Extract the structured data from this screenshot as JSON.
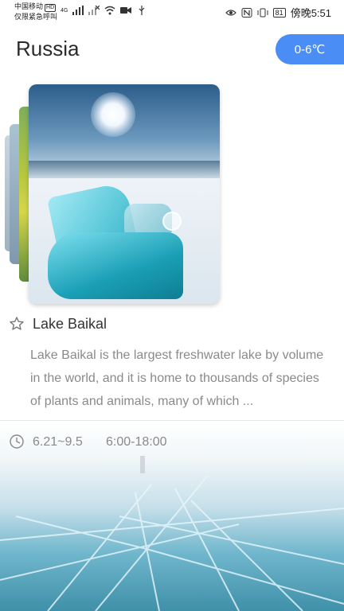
{
  "status_bar": {
    "carrier_line1": "中国移动",
    "carrier_hd": "HD",
    "carrier_line2": "仅限紧急呼叫",
    "network": "4G",
    "battery": "81",
    "time": "傍晚5:51"
  },
  "header": {
    "title": "Russia",
    "temperature": "0-6℃"
  },
  "attraction": {
    "name": "Lake Baikal",
    "description": "Lake Baikal is the largest freshwater lake by volume in the world, and it is home to thousands of species of plants and animals, many of which ...",
    "season": "6.21~9.5",
    "hours": "6:00-18:00"
  },
  "colors": {
    "accent": "#4a8ef5",
    "secondary_text": "#8a8a8a"
  },
  "icons": {
    "favorite": "star-outline-icon",
    "time": "clock-icon"
  }
}
